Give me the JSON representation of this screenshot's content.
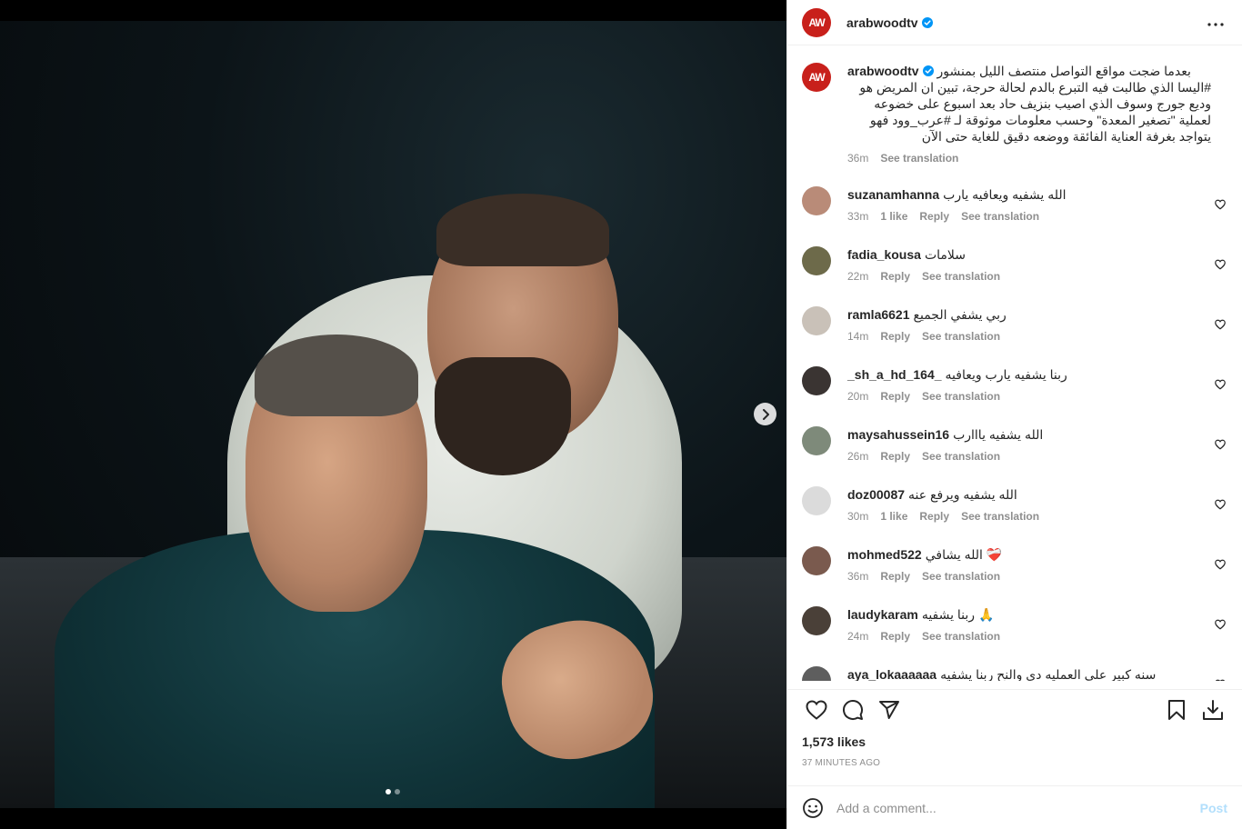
{
  "post": {
    "author": "arabwoodtv",
    "logo_text": "AW",
    "caption": {
      "lines": [
        "بعدما ضجت مواقع التواصل منتصف الليل بمنشور",
        "#اليسا الذي طالبت فيه التبرع بالدم لحالة حرجة، تبين ان المريض هو",
        "وديع جورج وسوف الذي اصيب بنزيف حاد بعد اسبوع على خضوعه",
        "لعملية \"تصغير المعدة\" وحسب معلومات موثوقة لـ #عرب_وود فهو",
        "يتواجد بغرفة العناية الفائقة ووضعه دقيق للغاية حتى الآن"
      ],
      "time": "36m",
      "see_translation": "See translation"
    }
  },
  "comments": [
    {
      "username": "suzanamhanna",
      "text": "الله يشفيه ويعافيه يارب",
      "time": "33m",
      "likes": "1 like",
      "reply": "Reply",
      "see_translation": "See translation"
    },
    {
      "username": "fadia_kousa",
      "text": "سلامات",
      "time": "22m",
      "likes": "",
      "reply": "Reply",
      "see_translation": "See translation"
    },
    {
      "username": "ramla6621",
      "text": "ربي يشفي الجميع",
      "time": "14m",
      "likes": "",
      "reply": "Reply",
      "see_translation": "See translation"
    },
    {
      "username": "_sh_a_hd_164_",
      "text": "ربنا يشفيه يارب ويعافيه",
      "time": "20m",
      "likes": "",
      "reply": "Reply",
      "see_translation": "See translation"
    },
    {
      "username": "maysahussein16",
      "text": "الله يشفيه يااارب",
      "time": "26m",
      "likes": "",
      "reply": "Reply",
      "see_translation": "See translation"
    },
    {
      "username": "doz00087",
      "text": "الله يشفيه ويرفع عنه",
      "time": "30m",
      "likes": "1 like",
      "reply": "Reply",
      "see_translation": "See translation"
    },
    {
      "username": "mohmed522",
      "text": "الله يشافي ❤️‍🩹",
      "time": "36m",
      "likes": "",
      "reply": "Reply",
      "see_translation": "See translation"
    },
    {
      "username": "laudykaram",
      "text": "ربنا يشفيه 🙏",
      "time": "24m",
      "likes": "",
      "reply": "Reply",
      "see_translation": "See translation"
    },
    {
      "username": "aya_lokaaaaaa",
      "text": "سنه كبير على العمليه دي والنح ربنا يشفيه",
      "time": "",
      "likes": "",
      "reply": "",
      "see_translation": ""
    }
  ],
  "likes": "1,573 likes",
  "time_ago": "37 MINUTES AGO",
  "add_comment": {
    "placeholder": "Add a comment...",
    "post_label": "Post"
  },
  "colors": {
    "brand": "#c8201b",
    "verified": "#0095f6",
    "link": "#00376b",
    "post_disabled": "#b2dffc"
  },
  "carousel": {
    "slides": 2,
    "current": 1
  }
}
